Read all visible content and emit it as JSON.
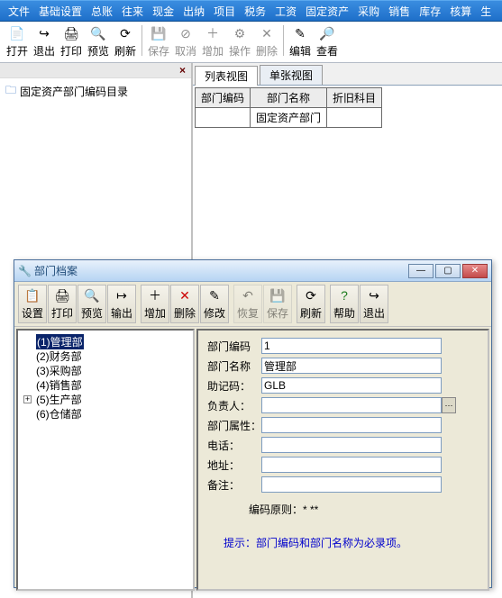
{
  "menu": [
    "文件",
    "基础设置",
    "总账",
    "往来",
    "现金",
    "出纳",
    "项目",
    "税务",
    "工资",
    "固定资产",
    "采购",
    "销售",
    "库存",
    "核算",
    "生"
  ],
  "toolbar_main": [
    {
      "icon": "📄",
      "label": "打开",
      "en": true
    },
    {
      "icon": "↪",
      "label": "退出",
      "en": true
    },
    {
      "icon": "🖨",
      "label": "打印",
      "en": true
    },
    {
      "icon": "🔍",
      "label": "预览",
      "en": true
    },
    {
      "icon": "⟳",
      "label": "刷新",
      "en": true
    },
    {
      "sep": true
    },
    {
      "icon": "💾",
      "label": "保存",
      "en": false
    },
    {
      "icon": "⊘",
      "label": "取消",
      "en": false
    },
    {
      "icon": "＋",
      "label": "增加",
      "en": false
    },
    {
      "icon": "⚙",
      "label": "操作",
      "en": false
    },
    {
      "icon": "✕",
      "label": "删除",
      "en": false
    },
    {
      "sep": true
    },
    {
      "icon": "✎",
      "label": "编辑",
      "en": true
    },
    {
      "icon": "🔎",
      "label": "查看",
      "en": true
    }
  ],
  "tree_root": "固定资产部门编码目录",
  "tree_close": "×",
  "tabs": [
    "列表视图",
    "单张视图"
  ],
  "table_headers": [
    "部门编码",
    "部门名称",
    "折旧科目"
  ],
  "table_row": [
    "",
    "固定资产部门",
    ""
  ],
  "dialog": {
    "title": "部门档案",
    "toolbar": [
      {
        "icon": "📋",
        "label": "设置",
        "en": true
      },
      {
        "icon": "🖨",
        "label": "打印",
        "en": true
      },
      {
        "icon": "🔍",
        "label": "预览",
        "en": true
      },
      {
        "icon": "↦",
        "label": "输出",
        "en": true
      },
      {
        "sep": true
      },
      {
        "icon": "＋",
        "label": "增加",
        "en": true
      },
      {
        "icon": "✕",
        "label": "删除",
        "en": true,
        "color": "#c00"
      },
      {
        "icon": "✎",
        "label": "修改",
        "en": true
      },
      {
        "sep": true
      },
      {
        "icon": "↶",
        "label": "恢复",
        "en": false
      },
      {
        "icon": "💾",
        "label": "保存",
        "en": false
      },
      {
        "sep": true
      },
      {
        "icon": "⟳",
        "label": "刷新",
        "en": true
      },
      {
        "sep": true
      },
      {
        "icon": "?",
        "label": "帮助",
        "en": true,
        "color": "#1a7a1a"
      },
      {
        "icon": "↪",
        "label": "退出",
        "en": true
      }
    ],
    "tree": [
      {
        "label": "(1)管理部",
        "selected": true
      },
      {
        "label": "(2)财务部"
      },
      {
        "label": "(3)采购部"
      },
      {
        "label": "(4)销售部"
      },
      {
        "label": "(5)生产部",
        "plus": true
      },
      {
        "label": "(6)仓储部"
      }
    ],
    "form": {
      "l_code": "部门编码",
      "v_code": "1",
      "l_name": "部门名称",
      "v_name": "管理部",
      "l_mnem": "助记码：",
      "v_mnem": "GLB",
      "l_owner": "负责人：",
      "v_owner": "",
      "l_attr": "部门属性：",
      "v_attr": "",
      "l_tel": "电话：",
      "v_tel": "",
      "l_addr": "地址：",
      "v_addr": "",
      "l_note": "备注：",
      "v_note": "",
      "rule": "编码原则：* **",
      "hint": "提示：部门编码和部门名称为必录项。"
    }
  }
}
